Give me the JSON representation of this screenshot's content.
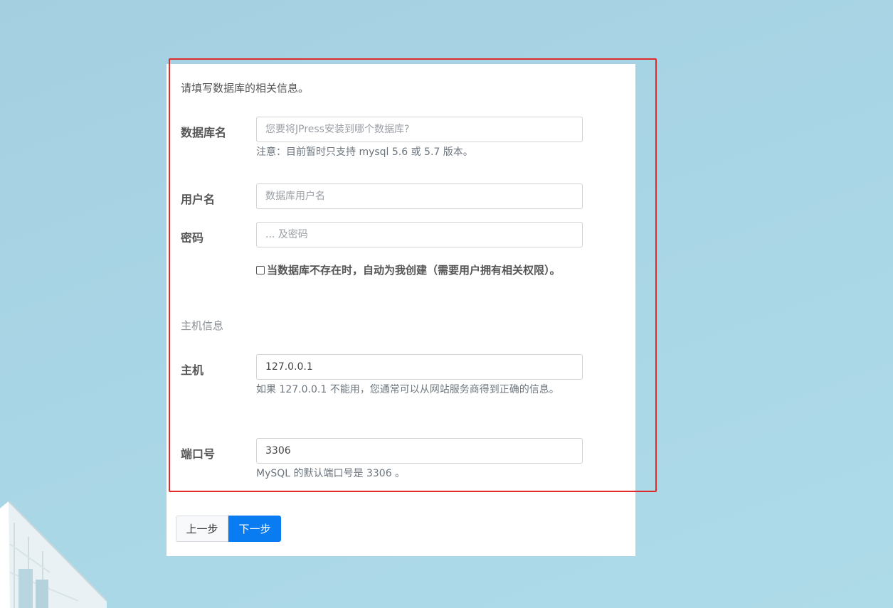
{
  "form": {
    "intro": "请填写数据库的相关信息。",
    "db_name": {
      "label": "数据库名",
      "placeholder": "您要将JPress安装到哪个数据库?",
      "value": "",
      "help": "注意：目前暂时只支持 mysql 5.6 或 5.7 版本。"
    },
    "username": {
      "label": "用户名",
      "placeholder": "数据库用户名",
      "value": ""
    },
    "password": {
      "label": "密码",
      "placeholder": "... 及密码",
      "value": ""
    },
    "auto_create": {
      "label": "当数据库不存在时，自动为我创建（需要用户拥有相关权限）。",
      "checked": false
    },
    "host_section": {
      "title": "主机信息"
    },
    "host": {
      "label": "主机",
      "value": "127.0.0.1",
      "help": "如果 127.0.0.1 不能用，您通常可以从网站服务商得到正确的信息。"
    },
    "port": {
      "label": "端口号",
      "value": "3306",
      "help": "MySQL 的默认端口号是 3306 。"
    }
  },
  "buttons": {
    "prev_label": "上一步",
    "next_label": "下一步"
  },
  "colors": {
    "highlight_border": "#e02b2b",
    "primary": "#0a7cf2",
    "background": "#a9d6e6"
  }
}
